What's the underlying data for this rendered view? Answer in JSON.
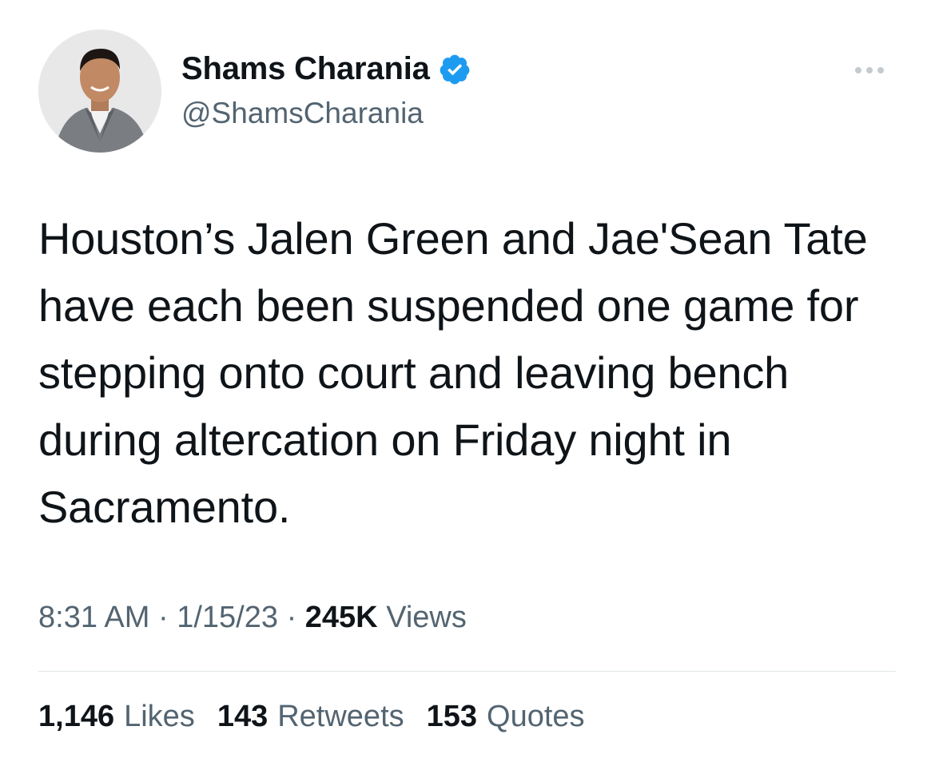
{
  "author": {
    "display_name": "Shams Charania",
    "handle": "@ShamsCharania",
    "verified": true
  },
  "tweet": {
    "text": "Houston’s Jalen Green and Jae'Sean Tate have each been suspended one game for stepping onto court and leaving bench during altercation on Friday night in Sacramento."
  },
  "meta": {
    "time": "8:31 AM",
    "sep1": "·",
    "date": "1/15/23",
    "sep2": "·",
    "views_count": "245K",
    "views_label": "Views"
  },
  "stats": {
    "likes_count": "1,146",
    "likes_label": "Likes",
    "retweets_count": "143",
    "retweets_label": "Retweets",
    "quotes_count": "153",
    "quotes_label": "Quotes"
  },
  "icons": {
    "verified_badge": "verified-badge-icon",
    "more": "more-icon"
  },
  "colors": {
    "verified_blue": "#1d9bf0",
    "text_primary": "#0f1419",
    "text_secondary": "#536471"
  }
}
